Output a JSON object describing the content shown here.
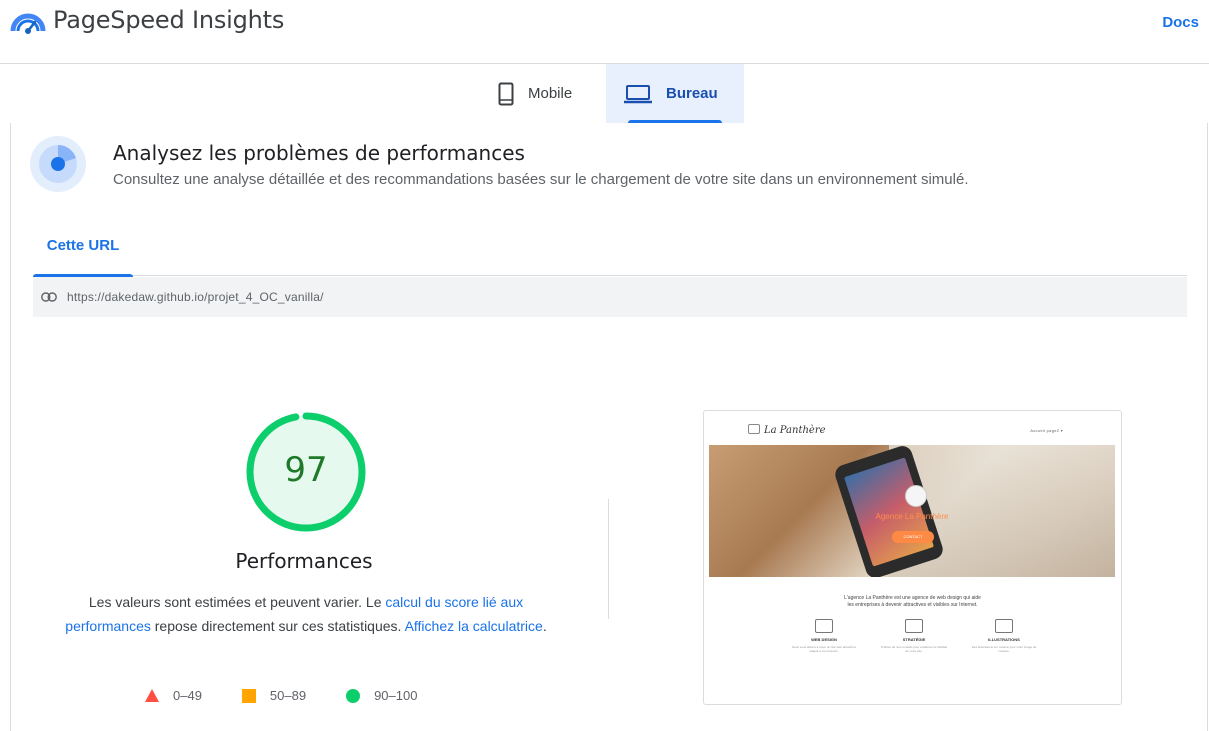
{
  "app": {
    "title": "PageSpeed Insights",
    "docs_label": "Docs"
  },
  "device_tabs": [
    {
      "label": "Mobile",
      "icon": "phone-icon",
      "selected": false
    },
    {
      "label": "Bureau",
      "icon": "laptop-icon",
      "selected": true
    }
  ],
  "analysis": {
    "title": "Analysez les problèmes de performances",
    "description": "Consultez une analyse détaillée et des recommandations basées sur le chargement de votre site dans un environnement simulé."
  },
  "url_tabs": [
    {
      "label": "Cette URL",
      "selected": true
    }
  ],
  "url": "https://dakedaw.github.io/projet_4_OC_vanilla/",
  "score": {
    "value": "97",
    "label": "Performances",
    "color": "#0cce6b"
  },
  "note": {
    "part1": "Les valeurs sont estimées et peuvent varier. Le ",
    "link1": "calcul du score lié aux performances",
    "part2": " repose directement sur ces statistiques. ",
    "link2": "Affichez la calculatrice",
    "part3": "."
  },
  "legend": [
    {
      "range": "0–49",
      "shape": "triangle",
      "color": "#ff4e42"
    },
    {
      "range": "50–89",
      "shape": "square",
      "color": "#ffa400"
    },
    {
      "range": "90–100",
      "shape": "circle",
      "color": "#0cce6b"
    }
  ],
  "thumbnail": {
    "brand": "La Panthère",
    "nav_links": "Accueil   page2 ▾",
    "hero_title": "Agence La Panthère",
    "hero_button": "CONTACT",
    "intro_line1": "L'agence La Panthère est une agence de web design qui aide",
    "intro_line2": "les entreprises à devenir attractives et visibles sur Internet.",
    "services": [
      {
        "title": "WEB DESIGN",
        "text": "Nous vous aidons à créer un site web attractif et adapté à vos besoins."
      },
      {
        "title": "STRATÉGIE",
        "text": "Profitez de nos conseils pour améliorer la visibilité de votre site."
      },
      {
        "title": "ILLUSTRATIONS",
        "text": "Des illustrations sur mesure pour votre image de marque."
      }
    ]
  }
}
